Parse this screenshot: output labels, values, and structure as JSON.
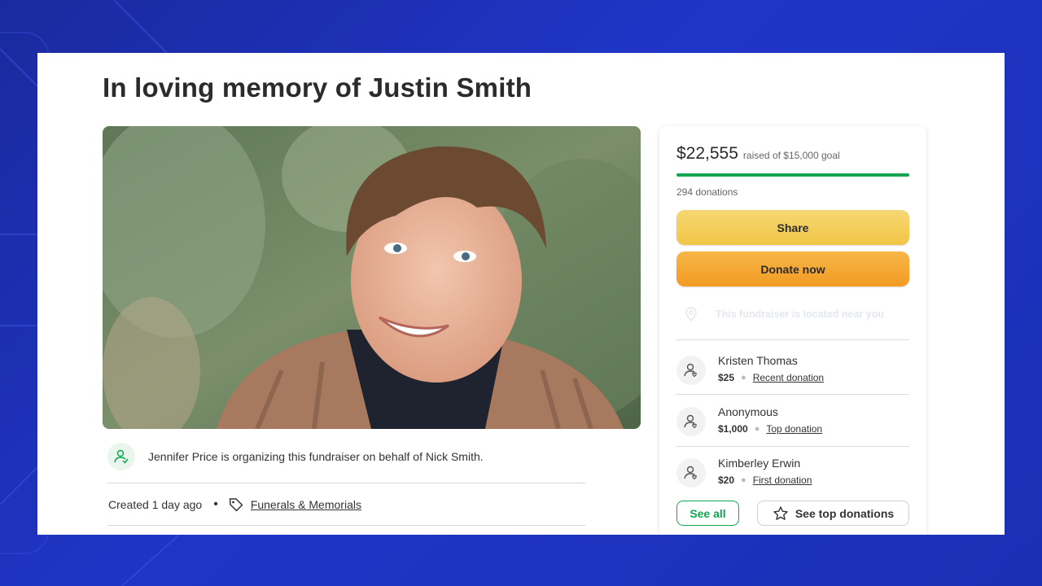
{
  "page": {
    "title": "In loving memory of Justin Smith"
  },
  "organizer": {
    "text": "Jennifer Price is organizing this fundraiser on behalf of Nick Smith."
  },
  "meta": {
    "created": "Created 1 day ago",
    "separator": "•",
    "category": "Funerals & Memorials"
  },
  "donation_panel": {
    "amount_raised": "$22,555",
    "goal_text": "raised of $15,000 goal",
    "progress_fraction": 1.0,
    "donation_count": "294 donations",
    "share_label": "Share",
    "donate_label": "Donate now",
    "location_text": "This fundraiser is located near you",
    "donors": [
      {
        "name": "Kristen Thomas",
        "amount": "$25",
        "kind": "Recent donation"
      },
      {
        "name": "Anonymous",
        "amount": "$1,000",
        "kind": "Top donation"
      },
      {
        "name": "Kimberley Erwin",
        "amount": "$20",
        "kind": "First donation"
      }
    ],
    "see_all_label": "See all",
    "see_top_label": "See top donations"
  },
  "colors": {
    "accent_green": "#12a650",
    "share_yellow": "#f1c645",
    "donate_orange": "#f29b22",
    "background_blue": "#1f35c8"
  },
  "icons": [
    "organizer-icon",
    "tag-icon",
    "location-pin-icon",
    "donor-icon",
    "star-icon"
  ]
}
